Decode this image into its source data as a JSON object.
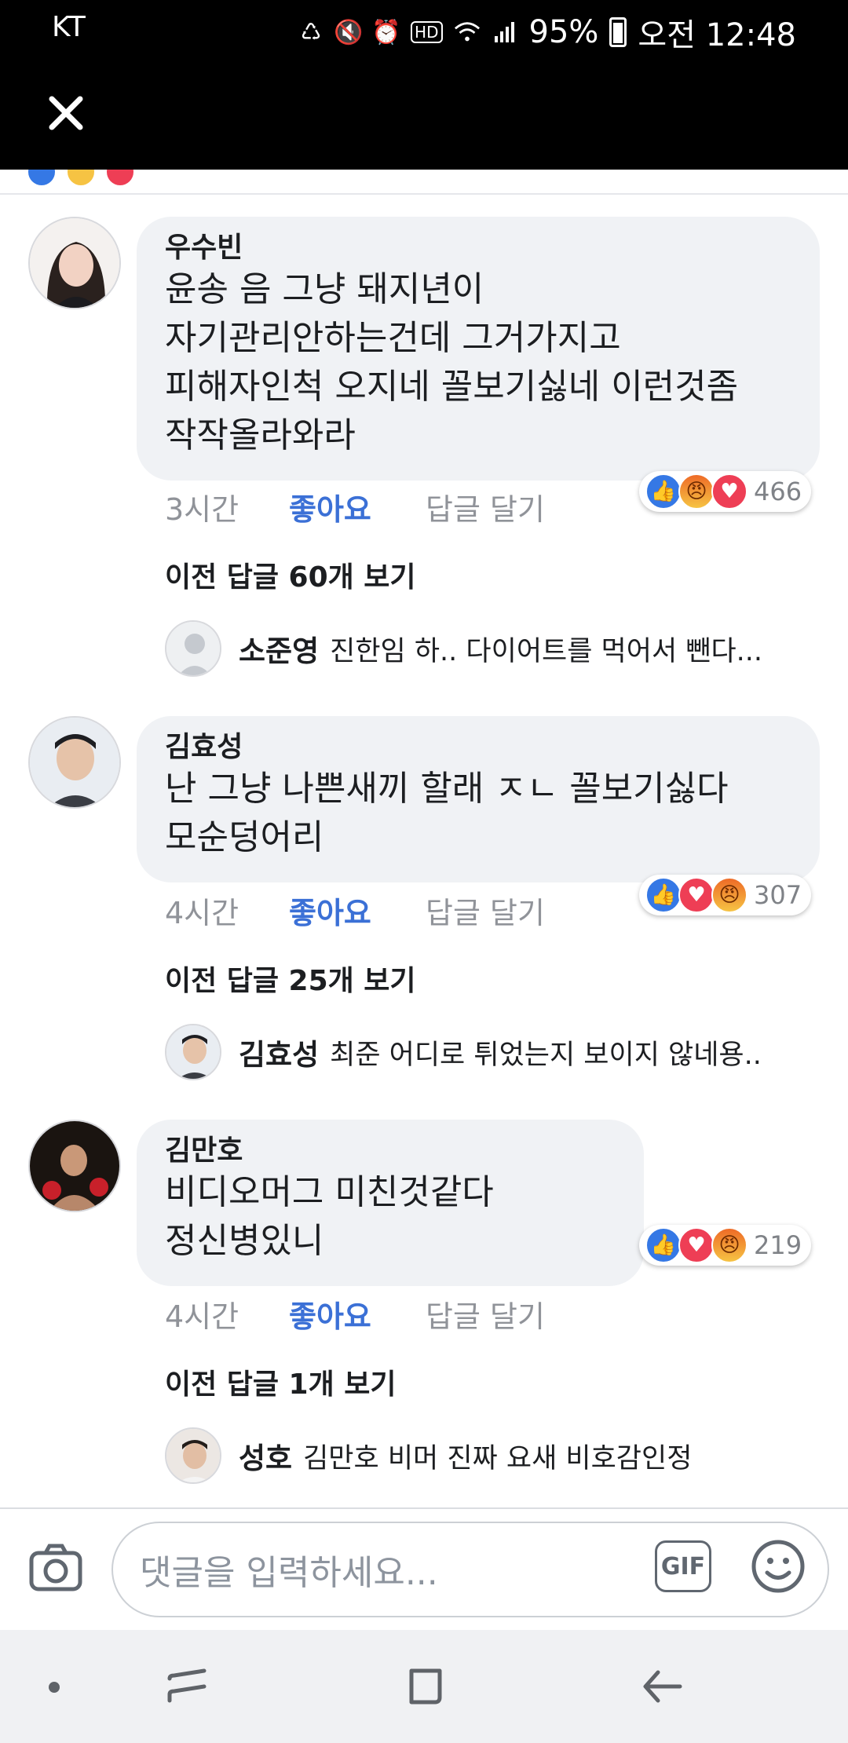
{
  "status": {
    "carrier": "KT",
    "hd": "HD",
    "battery": "95%",
    "time": "오전 12:48"
  },
  "comments": [
    {
      "author": "우수빈",
      "text": "윤송 음 그냥 돼지년이\n자기관리안하는건데 그거가지고\n피해자인척 오지네 꼴보기싫네 이런것좀\n작작올라와라",
      "time": "3시간",
      "like": "좋아요",
      "reply": "답글 달기",
      "reactions": [
        "like-icon",
        "angry-icon",
        "love-icon"
      ],
      "reaction_count": "466",
      "prev_replies": "이전 답글 60개 보기",
      "latest_reply": {
        "name": "소준영",
        "text": "진한임  하.. 다이어트를 먹어서 뺀다..."
      }
    },
    {
      "author": "김효성",
      "text": "난 그냥 나쁜새끼 할래 ㅈㄴ 꼴보기싫다\n모순덩어리",
      "time": "4시간",
      "like": "좋아요",
      "reply": "답글 달기",
      "reactions": [
        "like-icon",
        "love-icon",
        "angry-icon"
      ],
      "reaction_count": "307",
      "prev_replies": "이전 답글 25개 보기",
      "latest_reply": {
        "name": "김효성",
        "text": "최준 어디로 튀었는지 보이지 않네용.."
      }
    },
    {
      "author": "김만호",
      "text": "비디오머그 미친것같다\n정신병있니",
      "time": "4시간",
      "like": "좋아요",
      "reply": "답글 달기",
      "reactions": [
        "like-icon",
        "love-icon",
        "angry-icon"
      ],
      "reaction_count": "219",
      "prev_replies": "이전 답글 1개 보기",
      "latest_reply": {
        "name": "성호",
        "text": "김만호 비머 진짜 요새 비호감인정"
      }
    }
  ],
  "composer": {
    "placeholder": "댓글을 입력하세요...",
    "gif": "GIF"
  },
  "colors": {
    "accent": "#3b70d6",
    "bubble": "#f0f2f5",
    "like": "#3578e5",
    "love": "#ee3e55"
  }
}
